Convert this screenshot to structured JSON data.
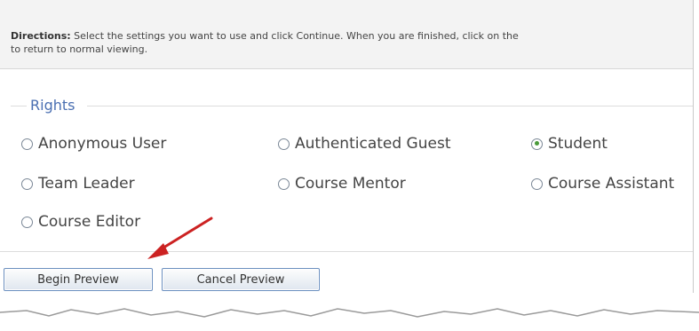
{
  "directions": {
    "label": "Directions:",
    "text": " Select the settings you want to use and click Continue. When you are finished, click on the",
    "line2": "to return to normal viewing."
  },
  "rights": {
    "legend": "Rights",
    "options": [
      {
        "label": "Anonymous User",
        "checked": false
      },
      {
        "label": "Authenticated Guest",
        "checked": false
      },
      {
        "label": "Student",
        "checked": true
      },
      {
        "label": "Team Leader",
        "checked": false
      },
      {
        "label": "Course Mentor",
        "checked": false
      },
      {
        "label": "Course Assistant",
        "checked": false
      },
      {
        "label": "Course Editor",
        "checked": false
      }
    ]
  },
  "buttons": {
    "begin": "Begin Preview",
    "cancel": "Cancel Preview"
  },
  "colors": {
    "legend": "#4a6fb2",
    "arrow": "#cc2222",
    "selected_radio": "#4a9a3a"
  }
}
